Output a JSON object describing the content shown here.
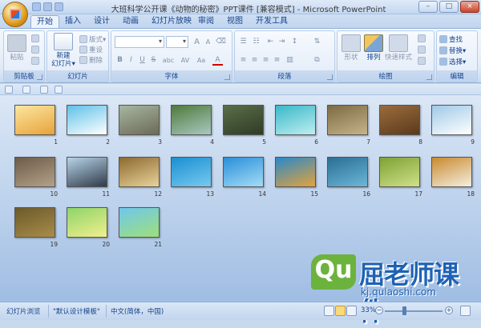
{
  "window": {
    "title": "大班科学公开课《动物的秘密》PPT课件 [兼容模式] - Microsoft PowerPoint",
    "controls": [
      "–",
      "□",
      "×"
    ]
  },
  "tabs": [
    "开始",
    "插入",
    "设计",
    "动画",
    "幻灯片放映",
    "审阅",
    "视图",
    "开发工具"
  ],
  "active_tab": "开始",
  "ribbon": {
    "clipboard": {
      "paste": "粘贴",
      "label": "剪贴板"
    },
    "slides": {
      "new_slide": "新建",
      "new_slide2": "幻灯片▾",
      "layout": "版式▾",
      "reset": "重设",
      "delete": "删除",
      "label": "幻灯片"
    },
    "font": {
      "label": "字体",
      "grow": "A",
      "shrink": "A",
      "bold": "B",
      "italic": "I",
      "underline": "U",
      "strike": "S",
      "shadow": "abc",
      "spacing": "AV",
      "case": "Aa",
      "color": "A"
    },
    "paragraph": {
      "label": "段落"
    },
    "drawing": {
      "shape": "形状",
      "arrange": "排列",
      "quick_styles": "快速样式",
      "label": "绘图"
    },
    "editing": {
      "find": "查找",
      "replace": "替换▾",
      "select": "选择▾",
      "label": "编辑"
    }
  },
  "slides": [
    {
      "num": "1",
      "colors": [
        "#fbe7a1",
        "#e8a23a"
      ]
    },
    {
      "num": "2",
      "colors": [
        "#5fc1e8",
        "#ffffff"
      ]
    },
    {
      "num": "3",
      "colors": [
        "#a7b6a0",
        "#6b6a58"
      ]
    },
    {
      "num": "4",
      "colors": [
        "#4f7a3c",
        "#a9c8c0"
      ]
    },
    {
      "num": "5",
      "colors": [
        "#5a6e4a",
        "#2f3b25"
      ]
    },
    {
      "num": "6",
      "colors": [
        "#39b8c9",
        "#bfeef0"
      ]
    },
    {
      "num": "7",
      "colors": [
        "#7d6a44",
        "#c5b48a"
      ]
    },
    {
      "num": "8",
      "colors": [
        "#9b6c3d",
        "#5a3a1c"
      ]
    },
    {
      "num": "9",
      "colors": [
        "#9fc9e8",
        "#ffffff"
      ]
    },
    {
      "num": "10",
      "colors": [
        "#6d5a48",
        "#b3a28a"
      ]
    },
    {
      "num": "11",
      "colors": [
        "#b7d4e8",
        "#2f3a4a"
      ]
    },
    {
      "num": "12",
      "colors": [
        "#8c6a2f",
        "#e9d29a"
      ]
    },
    {
      "num": "13",
      "colors": [
        "#1a8fd1",
        "#78c9f0"
      ]
    },
    {
      "num": "14",
      "colors": [
        "#2a8fd8",
        "#a3dcf6"
      ]
    },
    {
      "num": "15",
      "colors": [
        "#2a88c8",
        "#e3a33d"
      ]
    },
    {
      "num": "16",
      "colors": [
        "#2a6e94",
        "#6cb7d8"
      ]
    },
    {
      "num": "17",
      "colors": [
        "#7ea233",
        "#cfe08a"
      ]
    },
    {
      "num": "18",
      "colors": [
        "#c98a2f",
        "#f3efe0"
      ]
    },
    {
      "num": "19",
      "colors": [
        "#6b5a2a",
        "#a88c4a"
      ]
    },
    {
      "num": "20",
      "colors": [
        "#8ed46a",
        "#f2ef8c"
      ]
    },
    {
      "num": "21",
      "colors": [
        "#6fc7ec",
        "#9ee07a"
      ]
    }
  ],
  "watermark": {
    "logo": "Qu",
    "text": "屈老师课件",
    "url": "kj.qulaoshi.com"
  },
  "status": {
    "view": "幻灯片浏览",
    "theme": "\"默认设计模板\"",
    "language": "中文(简体，中国)",
    "zoom": "33%",
    "zoom_level": 0.33
  }
}
